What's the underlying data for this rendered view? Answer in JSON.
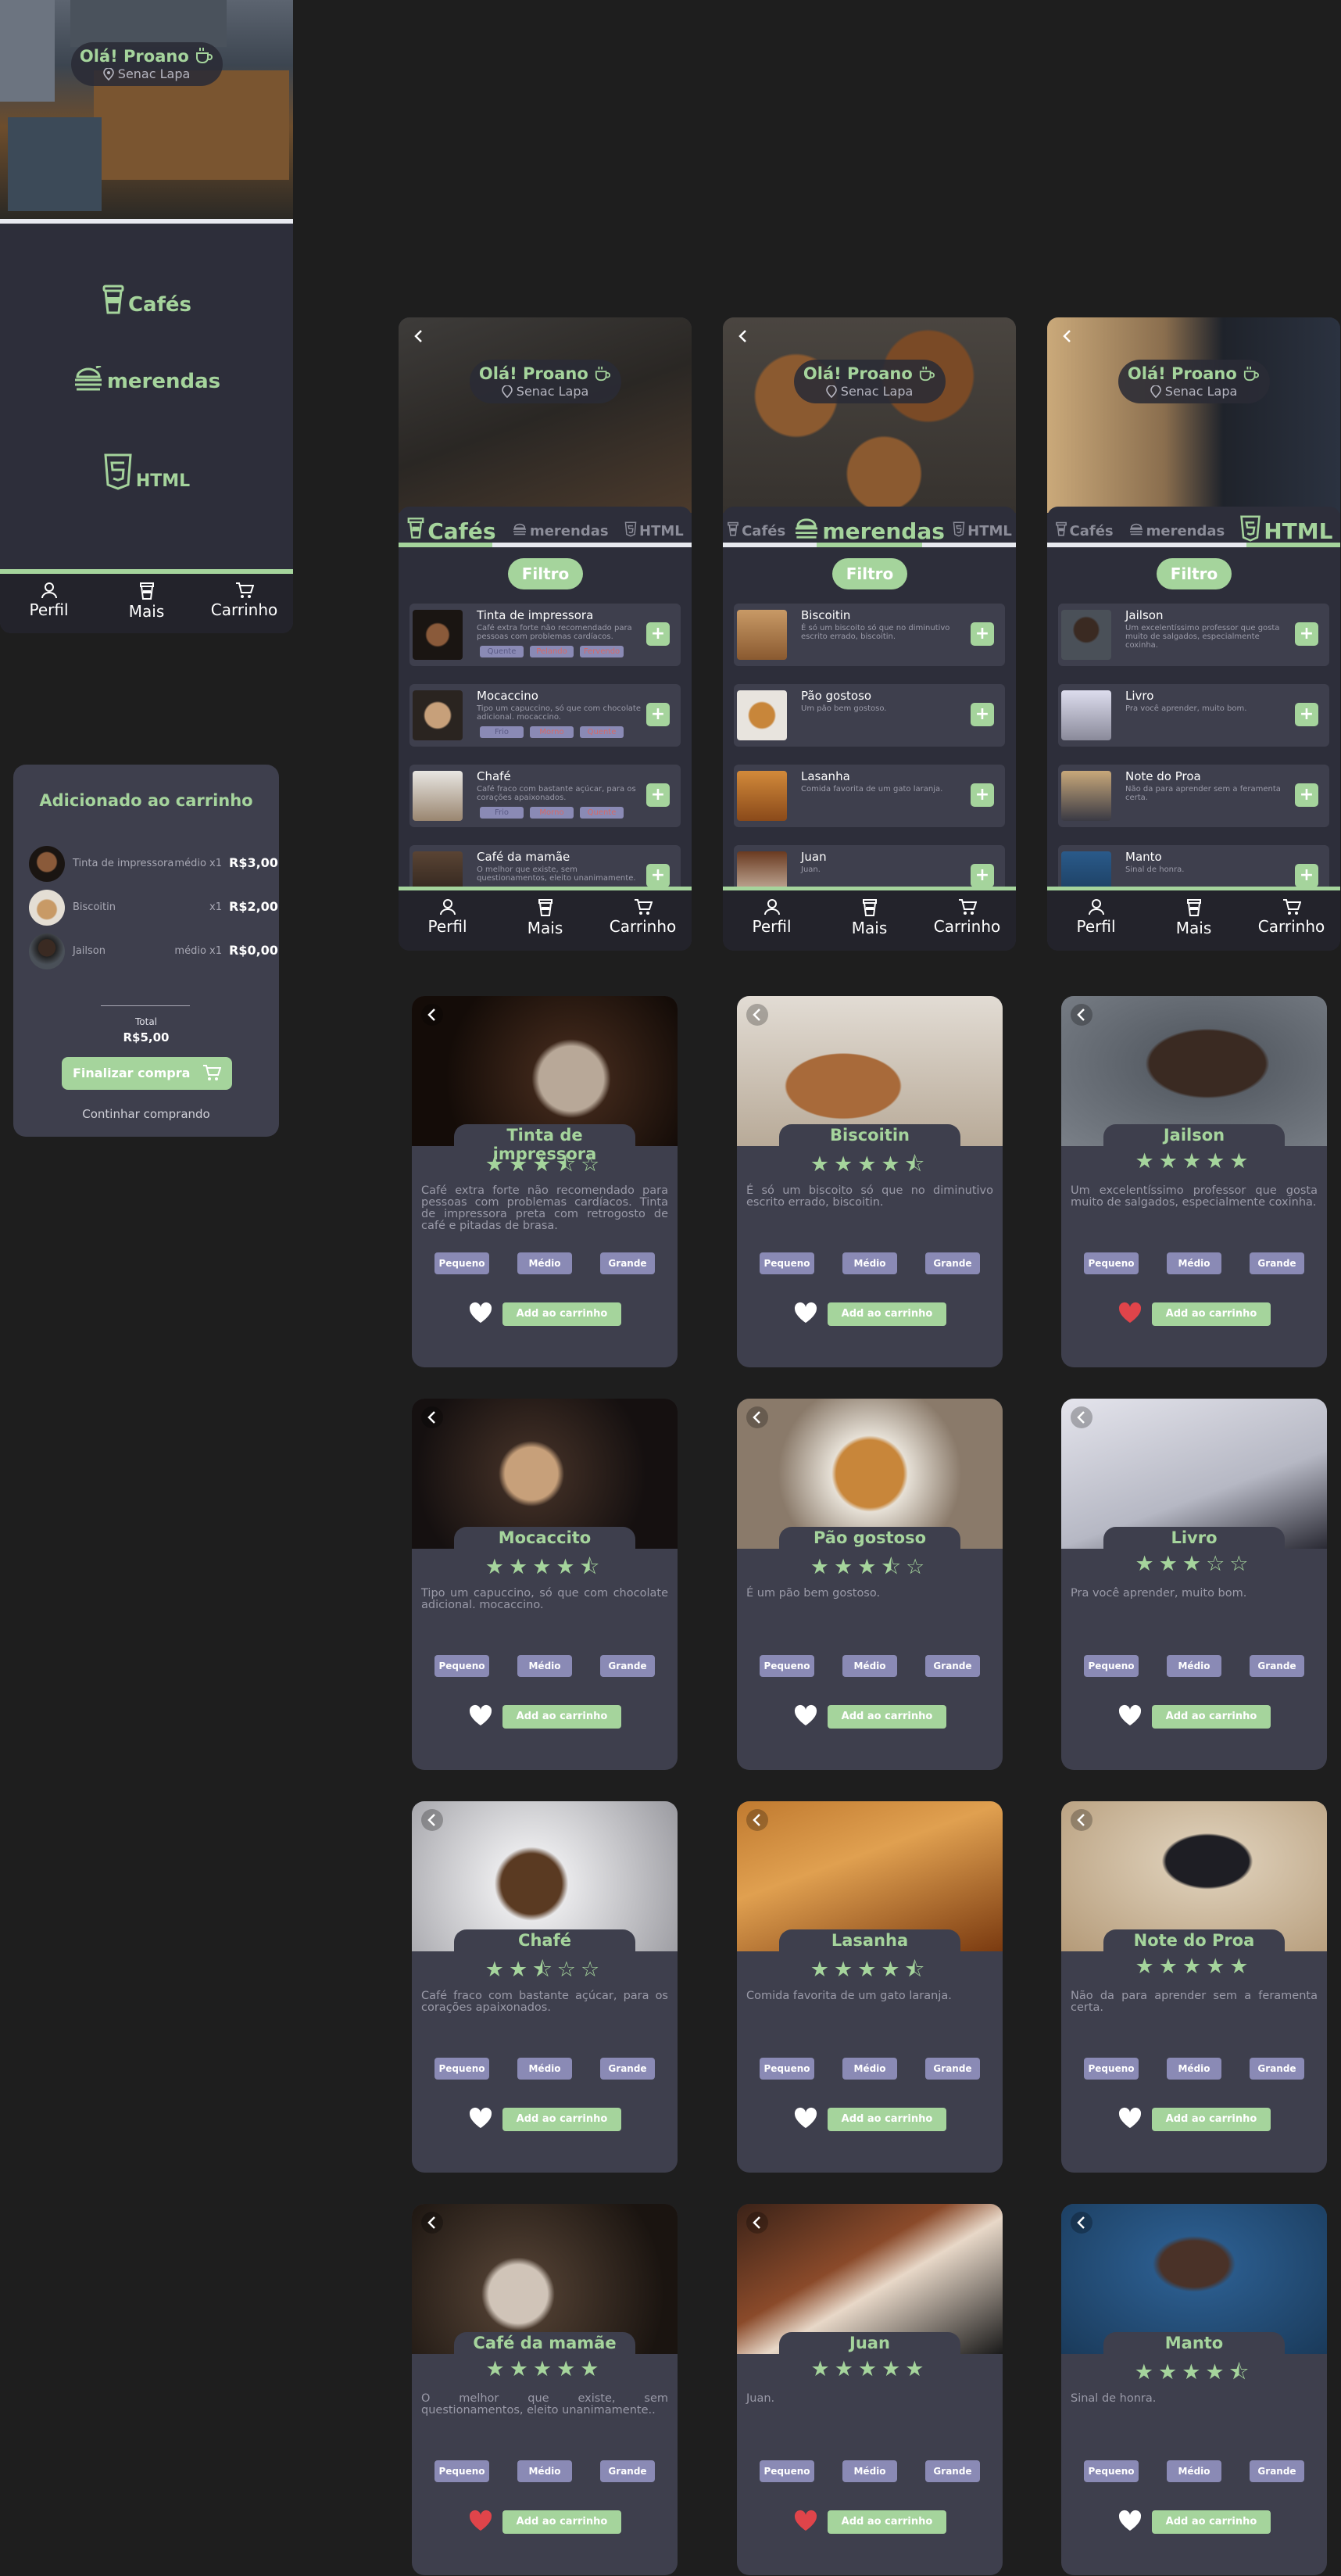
{
  "greeting": {
    "title": "Olá! Proano",
    "location": "Senac Lapa"
  },
  "home": {
    "categories": [
      {
        "label": "Cafés"
      },
      {
        "label": "merendas"
      },
      {
        "label": "HTML"
      }
    ]
  },
  "nav": {
    "profile": "Perfil",
    "more": "Mais",
    "cart": "Carrinho"
  },
  "cart": {
    "title": "Adicionado ao carrinho",
    "items": [
      {
        "name": "Tinta de impressora",
        "size": "médio x1",
        "price": "R$3,00"
      },
      {
        "name": "Biscoitin",
        "size": "x1",
        "price": "R$2,00"
      },
      {
        "name": "Jailson",
        "size": "médio x1",
        "price": "R$0,00"
      }
    ],
    "total_label": "Total",
    "total_value": "R$5,00",
    "checkout": "Finalizar compra",
    "continue": "Continhar comprando"
  },
  "screens": [
    {
      "tabs": [
        "Cafés",
        "merendas",
        "HTML"
      ],
      "active": 0,
      "filter": "Filtro",
      "items": [
        {
          "name": "Tinta de impressora",
          "desc": "Café extra forte não recomendado para pessoas com problemas cardíacos.",
          "chips": [
            "Quente",
            "Pelando",
            "Fervendo"
          ]
        },
        {
          "name": "Mocaccino",
          "desc": "Tipo um capuccino, só que com chocolate adicional. mocaccino.",
          "chips": [
            "Frio",
            "Morno",
            "Quente"
          ]
        },
        {
          "name": "Chafé",
          "desc": "Café fraco com bastante açúcar, para os corações apaixonados.",
          "chips": [
            "Frio",
            "Morno",
            "Quente"
          ]
        },
        {
          "name": "Café da mamãe",
          "desc": "O melhor que existe, sem questionamentos, eleito unanimamente.",
          "chips": []
        }
      ]
    },
    {
      "tabs": [
        "Cafés",
        "merendas",
        "HTML"
      ],
      "active": 1,
      "filter": "Filtro",
      "items": [
        {
          "name": "Biscoitin",
          "desc": "É só um biscoito só que no diminutivo escrito errado, biscoitin.",
          "chips": []
        },
        {
          "name": "Pão gostoso",
          "desc": "Um pão bem gostoso.",
          "chips": []
        },
        {
          "name": "Lasanha",
          "desc": "Comida favorita de um gato laranja.",
          "chips": []
        },
        {
          "name": "Juan",
          "desc": "Juan.",
          "chips": []
        }
      ]
    },
    {
      "tabs": [
        "Cafés",
        "merendas",
        "HTML"
      ],
      "active": 2,
      "filter": "Filtro",
      "items": [
        {
          "name": "Jailson",
          "desc": "Um excelentíssimo professor que gosta muito de salgados, especialmente coxinha.",
          "chips": []
        },
        {
          "name": "Livro",
          "desc": "Pra você aprender, muito bom.",
          "chips": []
        },
        {
          "name": "Note do Proa",
          "desc": "Não da para aprender sem a feramenta certa.",
          "chips": []
        },
        {
          "name": "Manto",
          "desc": "Sinal de honra.",
          "chips": []
        }
      ]
    }
  ],
  "sizes": [
    "Pequeno",
    "Médio",
    "Grande"
  ],
  "add_to_cart": "Add ao carrinho",
  "details": [
    {
      "name": "Tinta de impressora",
      "rating": 3.5,
      "stars": "★★★⯪☆",
      "liked": false,
      "desc": "Café extra forte não recomendado para pessoas com problemas cardíacos. Tinta de impressora preta com retrogosto de café e pitadas de brasa."
    },
    {
      "name": "Biscoitin",
      "rating": 4.5,
      "stars": "★★★★⯪",
      "liked": false,
      "desc": "É só um biscoito só que no diminutivo escrito errado, biscoitin."
    },
    {
      "name": "Jailson",
      "rating": 5,
      "stars": "★★★★★",
      "liked": true,
      "desc": "Um excelentíssimo professor que gosta muito de salgados, especialmente coxinha."
    },
    {
      "name": "Mocaccito",
      "rating": 4.5,
      "stars": "★★★★⯪",
      "liked": false,
      "desc": "Tipo um capuccino, só que com chocolate adicional. mocaccino."
    },
    {
      "name": "Pão gostoso",
      "rating": 3.5,
      "stars": "★★★⯪☆",
      "liked": false,
      "desc": "É um pão bem gostoso."
    },
    {
      "name": "Livro",
      "rating": 3,
      "stars": "★★★☆☆",
      "liked": false,
      "desc": "Pra você aprender, muito bom."
    },
    {
      "name": "Chafé",
      "rating": 2.5,
      "stars": "★★⯪☆☆",
      "liked": false,
      "desc": "Café fraco com bastante açúcar, para os corações apaixonados."
    },
    {
      "name": "Lasanha",
      "rating": 4.5,
      "stars": "★★★★⯪",
      "liked": false,
      "desc": "Comida favorita de um gato laranja."
    },
    {
      "name": "Note do Proa",
      "rating": 5,
      "stars": "★★★★★",
      "liked": false,
      "desc": "Não da para aprender sem a feramenta certa."
    },
    {
      "name": "Café da mamãe",
      "rating": 5,
      "stars": "★★★★★",
      "liked": true,
      "desc": "O melhor que existe, sem questionamentos, eleito unanimamente.."
    },
    {
      "name": "Juan",
      "rating": 5,
      "stars": "★★★★★",
      "liked": true,
      "desc": "Juan."
    },
    {
      "name": "Manto",
      "rating": 4.5,
      "stars": "★★★★⯪",
      "liked": false,
      "desc": "Sinal de honra."
    }
  ],
  "colors": {
    "accent": "#a5d49c",
    "card": "#3e3f4d",
    "screen": "#2d2e3a",
    "background": "#1e1e1e",
    "size_chip": "#8a8ab5",
    "heart_liked": "#e0444a"
  }
}
